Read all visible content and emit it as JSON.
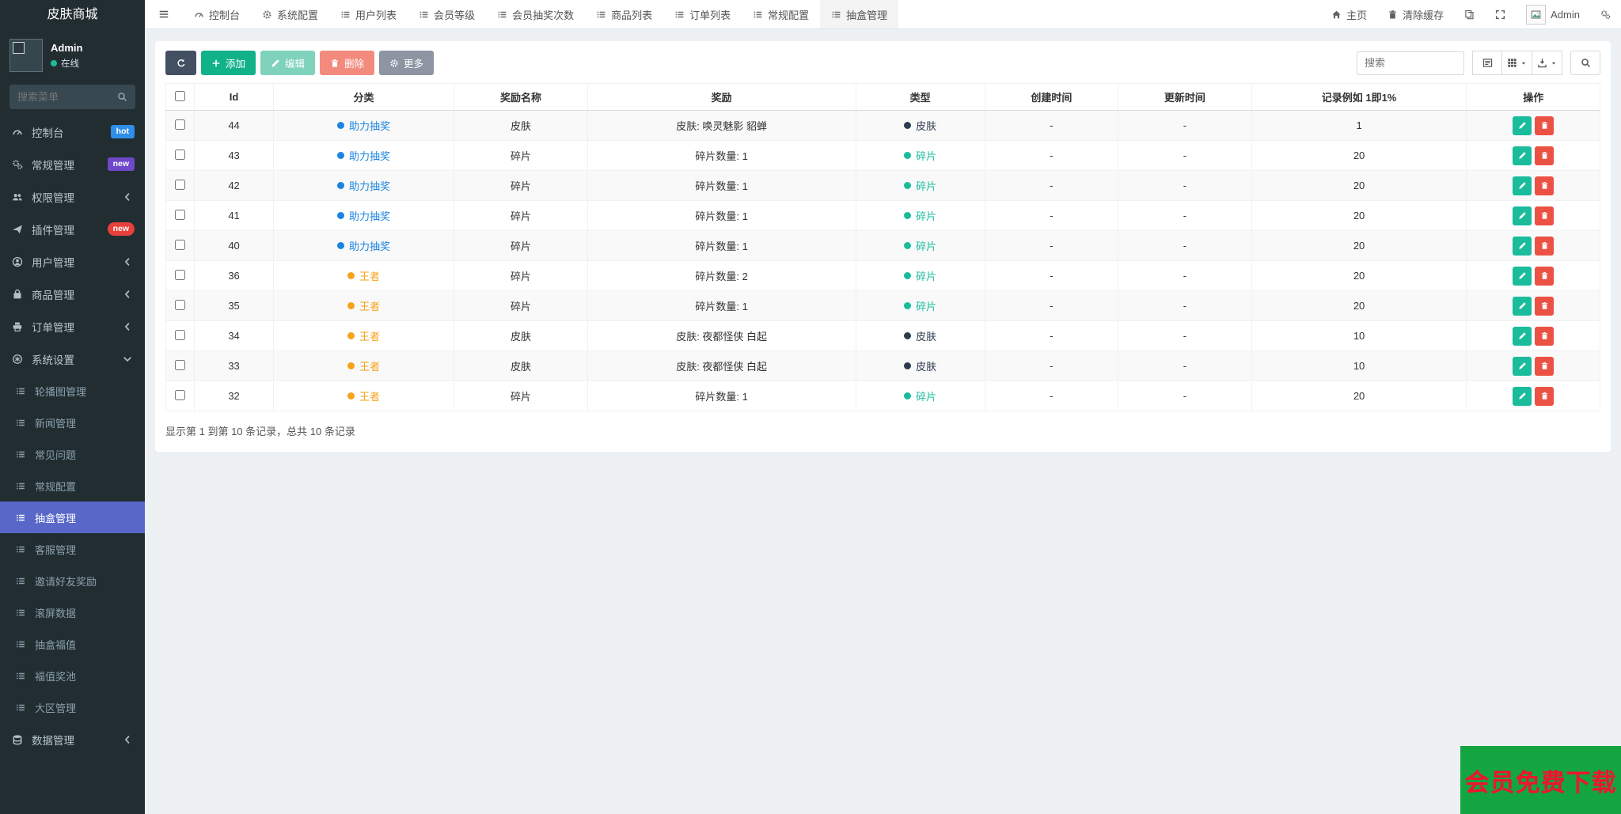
{
  "app": {
    "brand": "皮肤商城"
  },
  "sidebar": {
    "user": {
      "name": "Admin",
      "status": "在线",
      "status_color": "#1abc9c"
    },
    "search_placeholder": "搜索菜单",
    "menu": [
      {
        "label": "控制台",
        "icon": "gauge-icon",
        "badge": {
          "text": "hot",
          "color": "#2f8ee8",
          "pill": false
        }
      },
      {
        "label": "常规管理",
        "icon": "gears-icon",
        "badge": {
          "text": "new",
          "color": "#6e48c9",
          "pill": false
        }
      },
      {
        "label": "权限管理",
        "icon": "users-icon",
        "chevron": "left"
      },
      {
        "label": "插件管理",
        "icon": "plane-icon",
        "badge": {
          "text": "new",
          "color": "#e8403b",
          "pill": true
        }
      },
      {
        "label": "用户管理",
        "icon": "user-icon",
        "chevron": "left"
      },
      {
        "label": "商品管理",
        "icon": "bag-icon",
        "chevron": "left"
      },
      {
        "label": "订单管理",
        "icon": "printer-icon",
        "chevron": "left"
      },
      {
        "label": "系统设置",
        "icon": "asterisk-icon",
        "chevron": "down",
        "expanded": true,
        "submenu": [
          {
            "label": "轮播图管理"
          },
          {
            "label": "新闻管理"
          },
          {
            "label": "常见问题"
          },
          {
            "label": "常规配置"
          },
          {
            "label": "抽盒管理",
            "active": true,
            "active_color": "#5968c8"
          },
          {
            "label": "客服管理"
          },
          {
            "label": "邀请好友奖励"
          },
          {
            "label": "滚屏数据"
          },
          {
            "label": "抽盒福值"
          },
          {
            "label": "福值奖池"
          },
          {
            "label": "大区管理"
          }
        ]
      },
      {
        "label": "数据管理",
        "icon": "database-icon",
        "chevron": "left"
      }
    ]
  },
  "navbar": {
    "tabs": [
      {
        "label": "控制台",
        "icon": "gauge-icon"
      },
      {
        "label": "系统配置",
        "icon": "gear-icon"
      },
      {
        "label": "用户列表",
        "icon": "list-icon"
      },
      {
        "label": "会员等级",
        "icon": "list-icon"
      },
      {
        "label": "会员抽奖次数",
        "icon": "list-icon"
      },
      {
        "label": "商品列表",
        "icon": "list-icon"
      },
      {
        "label": "订单列表",
        "icon": "list-icon"
      },
      {
        "label": "常规配置",
        "icon": "list-icon"
      },
      {
        "label": "抽盒管理",
        "icon": "list-icon",
        "active": true
      }
    ],
    "right": {
      "home_label": "主页",
      "clear_cache_label": "清除缓存",
      "user_name": "Admin"
    }
  },
  "toolbar": {
    "add_label": "添加",
    "edit_label": "编辑",
    "delete_label": "删除",
    "more_label": "更多",
    "search_placeholder": "搜索"
  },
  "table": {
    "columns": [
      "Id",
      "分类",
      "奖励名称",
      "奖励",
      "类型",
      "创建时间",
      "更新时间",
      "记录例如 1即1%",
      "操作"
    ],
    "rows": [
      {
        "id": "44",
        "category": "助力抽奖",
        "category_color": "#1b84e0",
        "reward_name": "皮肤",
        "reward": "皮肤: 唤灵魅影 貂蝉",
        "type": "皮肤",
        "type_color": "#2c3c50",
        "created": "-",
        "updated": "-",
        "record": "1"
      },
      {
        "id": "43",
        "category": "助力抽奖",
        "category_color": "#1b84e0",
        "reward_name": "碎片",
        "reward": "碎片数量: 1",
        "type": "碎片",
        "type_color": "#1abc9c",
        "created": "-",
        "updated": "-",
        "record": "20"
      },
      {
        "id": "42",
        "category": "助力抽奖",
        "category_color": "#1b84e0",
        "reward_name": "碎片",
        "reward": "碎片数量: 1",
        "type": "碎片",
        "type_color": "#1abc9c",
        "created": "-",
        "updated": "-",
        "record": "20"
      },
      {
        "id": "41",
        "category": "助力抽奖",
        "category_color": "#1b84e0",
        "reward_name": "碎片",
        "reward": "碎片数量: 1",
        "type": "碎片",
        "type_color": "#1abc9c",
        "created": "-",
        "updated": "-",
        "record": "20"
      },
      {
        "id": "40",
        "category": "助力抽奖",
        "category_color": "#1b84e0",
        "reward_name": "碎片",
        "reward": "碎片数量: 1",
        "type": "碎片",
        "type_color": "#1abc9c",
        "created": "-",
        "updated": "-",
        "record": "20"
      },
      {
        "id": "36",
        "category": "王者",
        "category_color": "#f5a31a",
        "reward_name": "碎片",
        "reward": "碎片数量: 2",
        "type": "碎片",
        "type_color": "#1abc9c",
        "created": "-",
        "updated": "-",
        "record": "20"
      },
      {
        "id": "35",
        "category": "王者",
        "category_color": "#f5a31a",
        "reward_name": "碎片",
        "reward": "碎片数量: 1",
        "type": "碎片",
        "type_color": "#1abc9c",
        "created": "-",
        "updated": "-",
        "record": "20"
      },
      {
        "id": "34",
        "category": "王者",
        "category_color": "#f5a31a",
        "reward_name": "皮肤",
        "reward": "皮肤: 夜都怪侠 白起",
        "type": "皮肤",
        "type_color": "#2c3c50",
        "created": "-",
        "updated": "-",
        "record": "10"
      },
      {
        "id": "33",
        "category": "王者",
        "category_color": "#f5a31a",
        "reward_name": "皮肤",
        "reward": "皮肤: 夜都怪侠 白起",
        "type": "皮肤",
        "type_color": "#2c3c50",
        "created": "-",
        "updated": "-",
        "record": "10"
      },
      {
        "id": "32",
        "category": "王者",
        "category_color": "#f5a31a",
        "reward_name": "碎片",
        "reward": "碎片数量: 1",
        "type": "碎片",
        "type_color": "#1abc9c",
        "created": "-",
        "updated": "-",
        "record": "20"
      }
    ],
    "column_widths": [
      "2.0%",
      "5.5%",
      "12.6%",
      "9.3%",
      "18.7%",
      "9.0%",
      "9.3%",
      "9.3%",
      "15.0%",
      "9.3%"
    ]
  },
  "footer": {
    "summary": "显示第 1 到第 10 条记录，总共 10 条记录"
  },
  "watermark": {
    "text": "会员免费下载",
    "bg": "#13a53f",
    "color": "#f0132f"
  }
}
